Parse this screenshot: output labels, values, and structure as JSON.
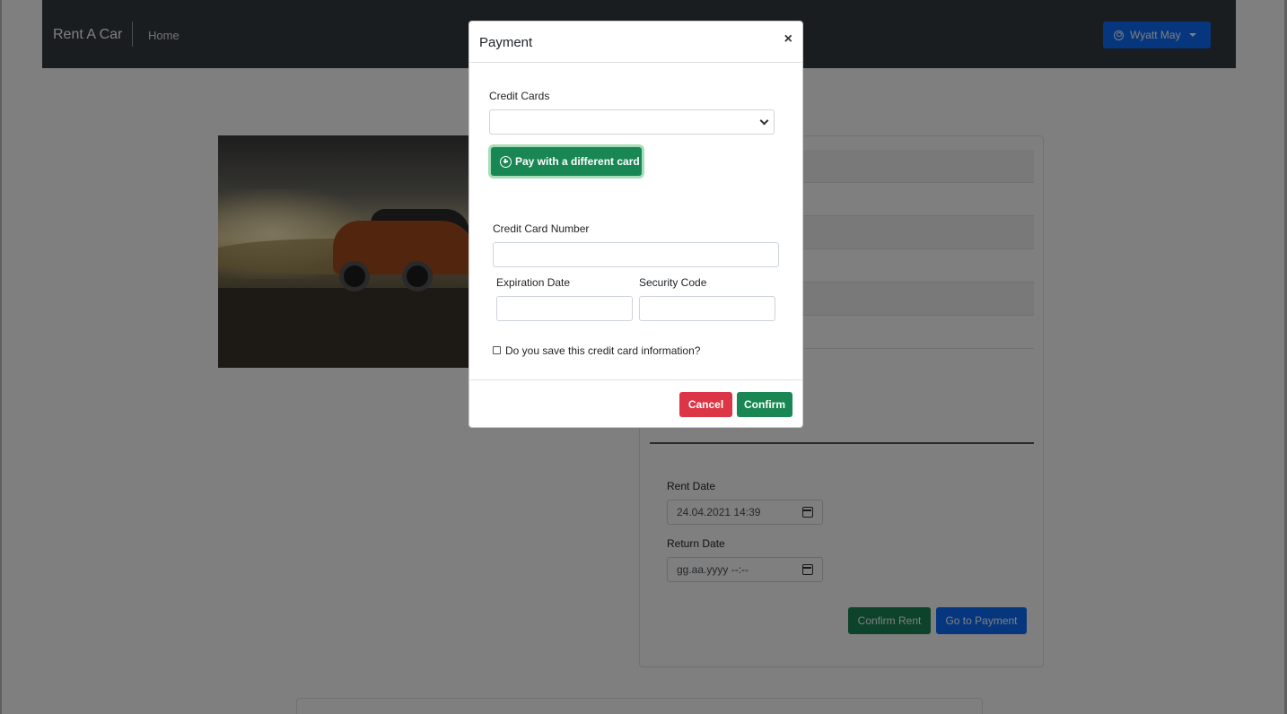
{
  "navbar": {
    "brand": "Rent A Car",
    "home_link": "Home",
    "user_name": "Wyatt May"
  },
  "rental_form": {
    "rent_date_label": "Rent Date",
    "rent_date_value": "24.04.2021 14:39",
    "return_date_label": "Return Date",
    "return_date_placeholder": "gg.aa.yyyy --:--",
    "confirm_rent_label": "Confirm Rent",
    "go_to_payment_label": "Go to Payment"
  },
  "modal": {
    "title": "Payment",
    "close_symbol": "×",
    "credit_cards_label": "Credit Cards",
    "credit_cards_selected": "",
    "pay_different_label": "Pay with a different card",
    "card_number_label": "Credit Card Number",
    "card_number_value": "",
    "expiration_label": "Expiration Date",
    "expiration_value": "",
    "security_label": "Security Code",
    "security_value": "",
    "save_card_label": "Do you save this credit card information?",
    "save_card_checked": false,
    "cancel_label": "Cancel",
    "confirm_label": "Confirm"
  },
  "colors": {
    "navbar_bg": "#343a40",
    "primary": "#0d6efd",
    "success": "#198754",
    "danger": "#dc3545",
    "backdrop": "rgba(0,0,0,0.5)"
  }
}
